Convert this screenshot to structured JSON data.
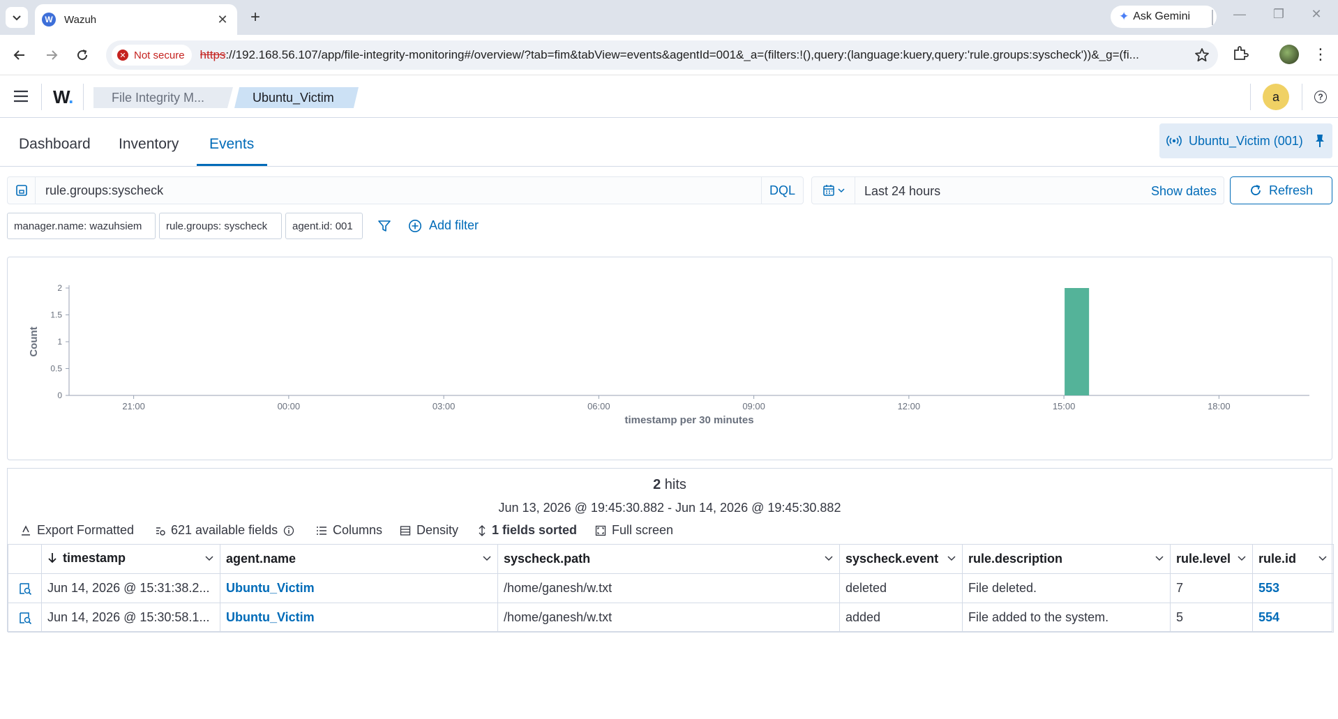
{
  "browser": {
    "tab_title": "Wazuh",
    "favicon_letter": "W",
    "gemini_label": "Ask Gemini",
    "not_secure_label": "Not secure",
    "url_scheme": "https",
    "url_rest": "://192.168.56.107/app/file-integrity-monitoring#/overview/?tab=fim&tabView=events&agentId=001&_a=(filters:!(),query:(language:kuery,query:'rule.groups:syscheck'))&_g=(fi..."
  },
  "header": {
    "logo_text": "W",
    "logo_dot": ".",
    "breadcrumbs": [
      "File Integrity M...",
      "Ubuntu_Victim"
    ],
    "avatar_letter": "a",
    "help_glyph": "?"
  },
  "tabs": [
    "Dashboard",
    "Inventory",
    "Events"
  ],
  "active_tab": "Events",
  "agent_pill": "Ubuntu_Victim (001)",
  "query": {
    "text": "rule.groups:syscheck",
    "language": "DQL"
  },
  "date": {
    "range_label": "Last 24 hours",
    "show_dates_label": "Show dates",
    "refresh_label": "Refresh"
  },
  "filters": [
    "manager.name: wazuhsiem",
    "rule.groups: syscheck",
    "agent.id: 001"
  ],
  "add_filter_label": "Add filter",
  "chart_data": {
    "type": "bar",
    "xlabel": "timestamp per 30 minutes",
    "ylabel": "Count",
    "y_ticks": [
      0,
      0.5,
      1,
      1.5,
      2
    ],
    "ylim": [
      0,
      2
    ],
    "x_ticks": [
      "21:00",
      "00:00",
      "03:00",
      "06:00",
      "09:00",
      "12:00",
      "15:00",
      "18:00"
    ],
    "x_tick_hours_from_start": [
      1.25,
      4.25,
      7.25,
      10.25,
      13.25,
      16.25,
      19.25,
      22.25
    ],
    "series": [
      {
        "bars": [
          {
            "start_hour_offset": 19.25,
            "bucket_label": "15:30",
            "value": 2
          }
        ]
      }
    ],
    "colors": {
      "bar": "#54b399",
      "axis": "#98a2b3"
    }
  },
  "results": {
    "hits_count": "2",
    "hits_label": " hits",
    "range_text": "Jun 13, 2026 @ 19:45:30.882 - Jun 14, 2026 @ 19:45:30.882",
    "toolbar": {
      "export": "Export Formatted",
      "fields": "621 available fields",
      "columns": "Columns",
      "density": "Density",
      "sorted": "1 fields sorted",
      "fullscreen": "Full screen"
    },
    "columns": [
      "timestamp",
      "agent.name",
      "syscheck.path",
      "syscheck.event",
      "rule.description",
      "rule.level",
      "rule.id"
    ],
    "rows": [
      [
        "Jun 14, 2026 @ 15:31:38.2...",
        "Ubuntu_Victim",
        "/home/ganesh/w.txt",
        "deleted",
        "File deleted.",
        "7",
        "553"
      ],
      [
        "Jun 14, 2026 @ 15:30:58.1...",
        "Ubuntu_Victim",
        "/home/ganesh/w.txt",
        "added",
        "File added to the system.",
        "5",
        "554"
      ]
    ]
  }
}
